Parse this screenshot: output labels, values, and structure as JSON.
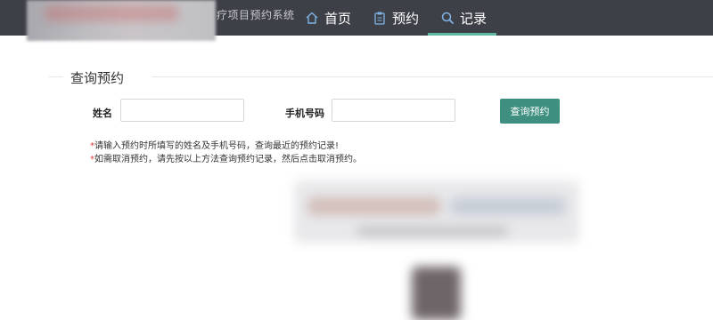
{
  "header": {
    "system_title": "疗项目预约系统",
    "nav": [
      {
        "label": "首页",
        "icon": "home-icon"
      },
      {
        "label": "预约",
        "icon": "clipboard-icon"
      },
      {
        "label": "记录",
        "icon": "search-icon",
        "active": true
      }
    ]
  },
  "form": {
    "section_title": "查询预约",
    "name_label": "姓名",
    "name_value": "",
    "phone_label": "手机号码",
    "phone_value": "",
    "submit_label": "查询预约"
  },
  "notes": {
    "star": "*",
    "line1": "请输入预约时所填写的姓名及手机号码，查询最近的预约记录!",
    "line2": "如需取消预约，请先按以上方法查询预约记录，然后点击取消预约。"
  },
  "colors": {
    "topbar": "#3d4147",
    "accent": "#3e8f80",
    "active_underline": "#5fb8a0",
    "asterisk": "#e23c3c"
  }
}
